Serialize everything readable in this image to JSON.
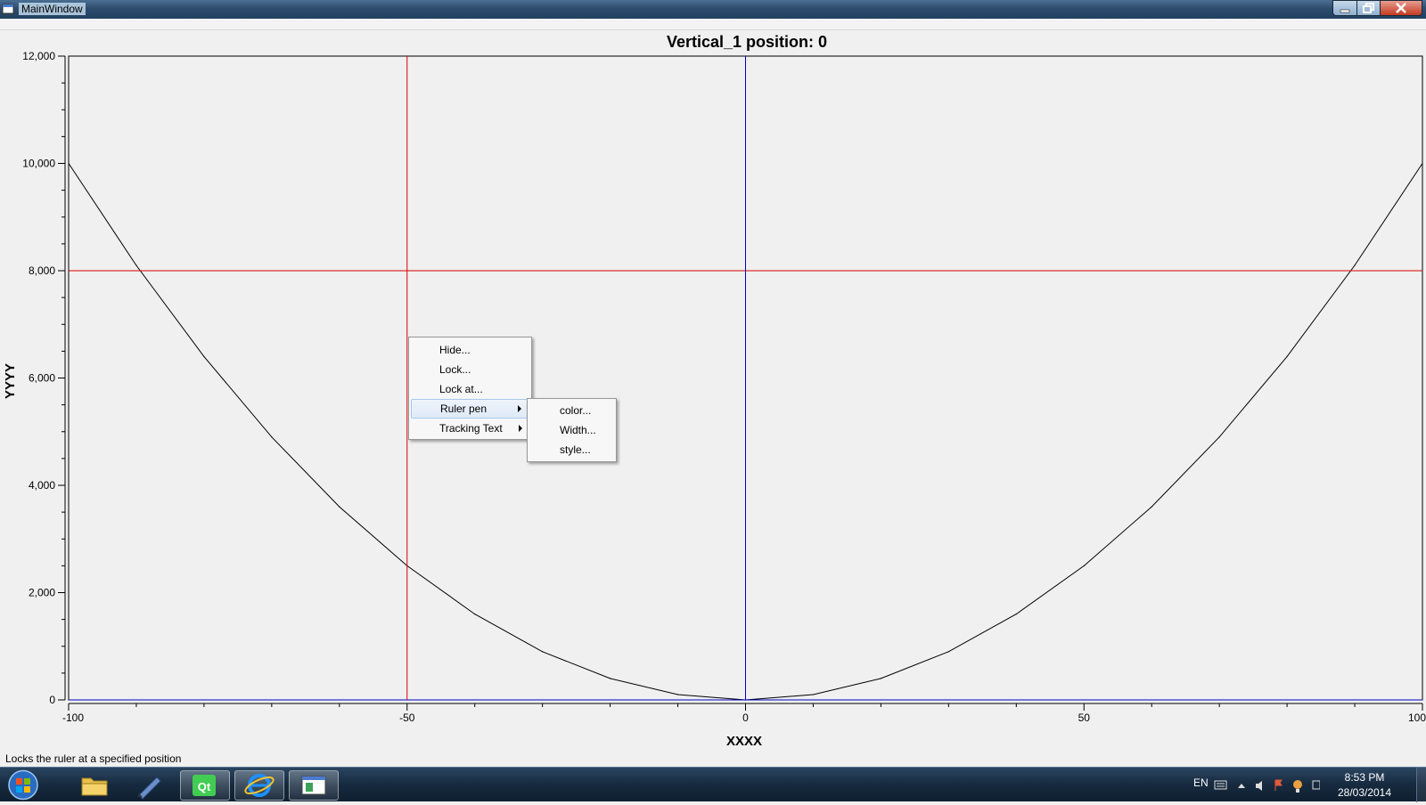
{
  "window": {
    "title": "MainWindow"
  },
  "chart_data": {
    "type": "line",
    "title": "Vertical_1 position: 0",
    "xlabel": "XXXX",
    "ylabel": "YYYY",
    "xlim": [
      -100,
      100
    ],
    "ylim": [
      0,
      12000
    ],
    "x_ticks": [
      -100,
      -50,
      0,
      50,
      100
    ],
    "x_tick_labels": [
      "-100",
      "-50",
      "0",
      "50",
      "100"
    ],
    "y_ticks": [
      0,
      2000,
      4000,
      6000,
      8000,
      10000,
      12000
    ],
    "y_tick_labels": [
      "0",
      "2,000",
      "4,000",
      "6,000",
      "8,000",
      "10,000",
      "12,000"
    ],
    "series": [
      {
        "color": "#000000",
        "x": [
          -100,
          -90,
          -80,
          -70,
          -60,
          -50,
          -40,
          -30,
          -20,
          -10,
          0,
          10,
          20,
          30,
          40,
          50,
          60,
          70,
          80,
          90,
          100
        ],
        "y": [
          10000,
          8100,
          6400,
          4900,
          3600,
          2500,
          1600,
          900,
          400,
          100,
          0,
          100,
          400,
          900,
          1600,
          2500,
          3600,
          4900,
          6400,
          8100,
          10000
        ]
      }
    ],
    "rulers": {
      "vertical": [
        {
          "x": -50,
          "color": "#d40000"
        },
        {
          "x": 0,
          "color": "#0000c0"
        }
      ],
      "horizontal": [
        {
          "y": 8000,
          "color": "#d40000"
        },
        {
          "y": 0,
          "color": "#0000c0"
        }
      ]
    },
    "grid": false
  },
  "context_menu": {
    "items": [
      {
        "label": "Hide...",
        "has_submenu": false,
        "highlighted": false
      },
      {
        "label": "Lock...",
        "has_submenu": false,
        "highlighted": false
      },
      {
        "label": "Lock at...",
        "has_submenu": false,
        "highlighted": false
      },
      {
        "label": "Ruler pen",
        "has_submenu": true,
        "highlighted": true
      },
      {
        "label": "Tracking Text",
        "has_submenu": true,
        "highlighted": false
      }
    ],
    "submenu": {
      "items": [
        {
          "label": "color..."
        },
        {
          "label": "Width..."
        },
        {
          "label": "style..."
        }
      ]
    }
  },
  "status_bar": {
    "text": "Locks the ruler at a specified position"
  },
  "taskbar": {
    "items": [
      "folder-icon",
      "pen-tool-icon",
      "qt-creator-icon",
      "internet-explorer-icon",
      "app-window-icon"
    ],
    "tray": {
      "lang": "EN",
      "time": "8:53 PM",
      "date": "28/03/2014"
    }
  }
}
